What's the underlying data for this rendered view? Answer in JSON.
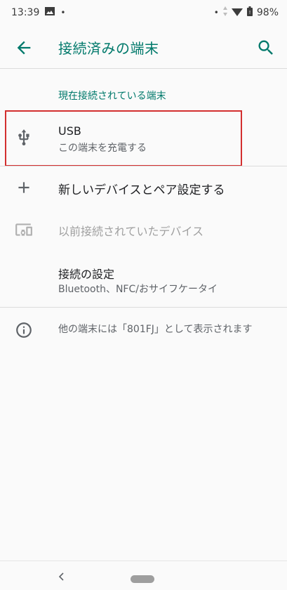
{
  "status_bar": {
    "time": "13:39",
    "battery": "98%",
    "dot": "•",
    "icons": [
      "image-icon",
      "notification-dot-icon",
      "data-arrows-icon",
      "wifi-icon",
      "battery-icon"
    ]
  },
  "app_bar": {
    "title": "接続済みの端末",
    "back_icon": "arrow-back-icon",
    "search_icon": "search-icon",
    "accent_color": "#00796b"
  },
  "section_header": "現在接続されている端末",
  "items": [
    {
      "icon": "usb-icon",
      "title": "USB",
      "subtitle": "この端末を充電する"
    },
    {
      "icon": "plus-icon",
      "title": "新しいデバイスとペア設定する"
    },
    {
      "icon": "devices-icon",
      "title": "以前接続されていたデバイス"
    },
    {
      "title": "接続の設定",
      "subtitle": "Bluetooth、NFC/おサイフケータイ"
    }
  ],
  "info": {
    "icon": "info-icon",
    "text": "他の端末には「801FJ」として表示されます"
  },
  "nav_bar": {
    "back_icon": "nav-back-icon",
    "home_icon": "nav-home-pill-icon"
  },
  "colors": {
    "highlight": "#d32f2f",
    "disabled_text": "#a0a0a0"
  }
}
